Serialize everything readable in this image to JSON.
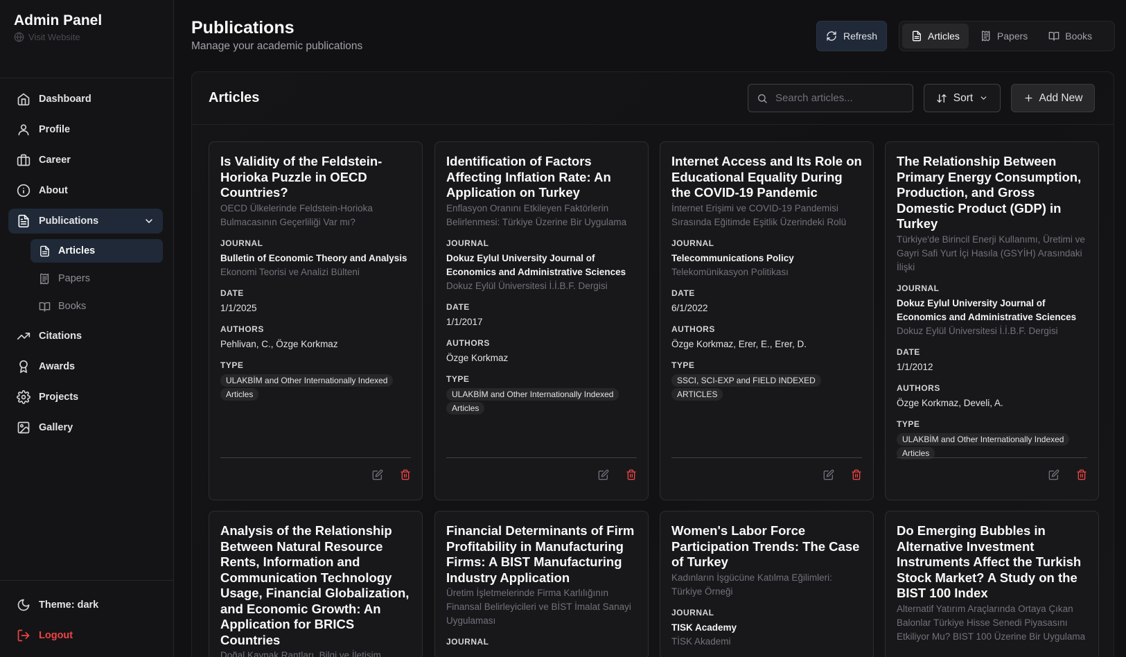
{
  "app": {
    "title": "Admin Panel",
    "visit_label": "Visit Website"
  },
  "sidebar": {
    "items": [
      {
        "label": "Dashboard",
        "icon": "home-icon"
      },
      {
        "label": "Profile",
        "icon": "user-icon"
      },
      {
        "label": "Career",
        "icon": "briefcase-icon"
      },
      {
        "label": "About",
        "icon": "info-icon"
      },
      {
        "label": "Publications",
        "icon": "file-text-icon"
      },
      {
        "label": "Citations",
        "icon": "trending-up-icon"
      },
      {
        "label": "Awards",
        "icon": "award-icon"
      },
      {
        "label": "Projects",
        "icon": "gear-icon"
      },
      {
        "label": "Gallery",
        "icon": "image-icon"
      }
    ],
    "sub_items": [
      {
        "label": "Articles",
        "icon": "file-text-icon"
      },
      {
        "label": "Papers",
        "icon": "receipt-icon"
      },
      {
        "label": "Books",
        "icon": "book-open-icon"
      }
    ],
    "theme_label": "Theme: dark",
    "logout_label": "Logout"
  },
  "header": {
    "title": "Publications",
    "subtitle": "Manage your academic publications",
    "refresh_label": "Refresh",
    "tabs": [
      {
        "label": "Articles",
        "icon": "file-text-icon"
      },
      {
        "label": "Papers",
        "icon": "receipt-icon"
      },
      {
        "label": "Books",
        "icon": "book-open-icon"
      }
    ]
  },
  "panel": {
    "title": "Articles",
    "search_placeholder": "Search articles...",
    "sort_label": "Sort",
    "add_label": "Add New"
  },
  "labels": {
    "journal": "JOURNAL",
    "date": "DATE",
    "authors": "AUTHORS",
    "type": "TYPE"
  },
  "articles": [
    {
      "title": "Is Validity of the Feldstein-Horioka Puzzle in OECD Countries?",
      "title_tr": "OECD Ülkelerinde Feldstein-Horioka Bulmacasının Geçerliliği Var mı?",
      "journal": "Bulletin of Economic Theory and Analysis",
      "journal_tr": "Ekonomi Teorisi ve Analizi Bülteni",
      "date": "1/1/2025",
      "authors": "Pehlivan, C., Özge Korkmaz",
      "type": "ULAKBİM and Other Internationally Indexed Articles"
    },
    {
      "title": "Identification of Factors Affecting Inflation Rate: An Application on Turkey",
      "title_tr": "Enflasyon Oranını Etkileyen Faktörlerin Belirlenmesi: Türkiye Üzerine Bir Uygulama",
      "journal": "Dokuz Eylul University Journal of Economics and Administrative Sciences",
      "journal_tr": "Dokuz Eylül Üniversitesi İ.İ.B.F. Dergisi",
      "date": "1/1/2017",
      "authors": "Özge Korkmaz",
      "type": "ULAKBİM and Other Internationally Indexed Articles"
    },
    {
      "title": "Internet Access and Its Role on Educational Equality During the COVID-19 Pandemic",
      "title_tr": "İnternet Erişimi ve COVID-19 Pandemisi Sırasında Eğitimde Eşitlik Üzerindeki Rolü",
      "journal": "Telecommunications Policy",
      "journal_tr": "Telekomünikasyon Politikası",
      "date": "6/1/2022",
      "authors": "Özge Korkmaz, Erer, E., Erer, D.",
      "type": "SSCI, SCI-EXP and FIELD INDEXED ARTICLES"
    },
    {
      "title": "The Relationship Between Primary Energy Consumption, Production, and Gross Domestic Product (GDP) in Turkey",
      "title_tr": "Türkiye'de Birincil Enerji Kullanımı, Üretimi ve Gayri Safi Yurt İçi Hasıla (GSYİH) Arasındaki İlişki",
      "journal": "Dokuz Eylul University Journal of Economics and Administrative Sciences",
      "journal_tr": "Dokuz Eylül Üniversitesi İ.İ.B.F. Dergisi",
      "date": "1/1/2012",
      "authors": "Özge Korkmaz, Develi, A.",
      "type": "ULAKBİM and Other Internationally Indexed Articles"
    },
    {
      "title": "Analysis of the Relationship Between Natural Resource Rents, Information and Communication Technology Usage, Financial Globalization, and Economic Growth: An Application for BRICS Countries",
      "title_tr": "Doğal Kaynak Rantları, Bilgi ve İletişim Teknoloji Kullanımı, Finansal Küreselleşme"
    },
    {
      "title": "Financial Determinants of Firm Profitability in Manufacturing Firms: A BIST Manufacturing Industry Application",
      "title_tr": "Üretim İşletmelerinde Firma Karlılığının Finansal Belirleyicileri ve BİST İmalat Sanayi Uygulaması"
    },
    {
      "title": "Women's Labor Force Participation Trends: The Case of Turkey",
      "title_tr": "Kadınların İşgücüne Katılma Eğilimleri: Türkiye Örneği",
      "journal": "TISK Academy",
      "journal_tr": "TİSK Akademi"
    },
    {
      "title": "Do Emerging Bubbles in Alternative Investment Instruments Affect the Turkish Stock Market? A Study on the BIST 100 Index",
      "title_tr": "Alternatif Yatırım Araçlarında Ortaya Çıkan Balonlar Türkiye Hisse Senedi Piyasasını Etkiliyor Mu? BIST 100 Üzerine Bir Uygulama"
    }
  ]
}
